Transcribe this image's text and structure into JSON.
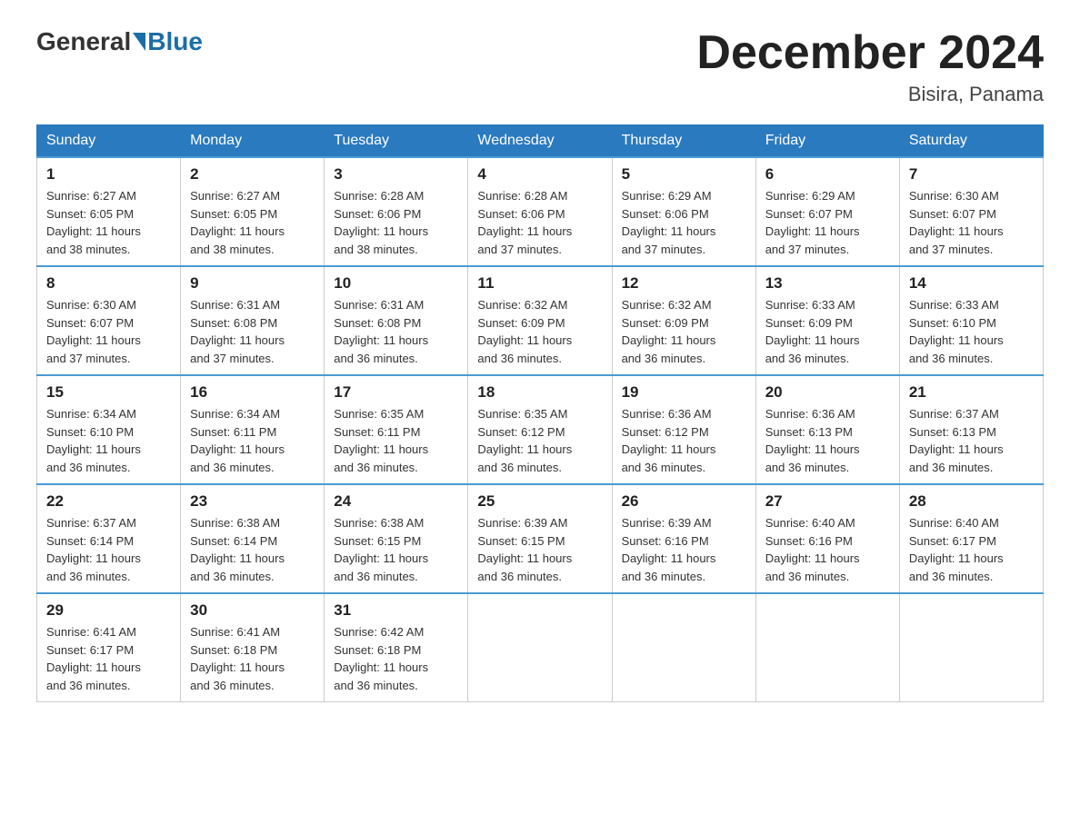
{
  "header": {
    "logo_general": "General",
    "logo_blue": "Blue",
    "title": "December 2024",
    "subtitle": "Bisira, Panama"
  },
  "days_of_week": [
    "Sunday",
    "Monday",
    "Tuesday",
    "Wednesday",
    "Thursday",
    "Friday",
    "Saturday"
  ],
  "weeks": [
    [
      {
        "date": "1",
        "sunrise": "6:27 AM",
        "sunset": "6:05 PM",
        "daylight": "11 hours and 38 minutes."
      },
      {
        "date": "2",
        "sunrise": "6:27 AM",
        "sunset": "6:05 PM",
        "daylight": "11 hours and 38 minutes."
      },
      {
        "date": "3",
        "sunrise": "6:28 AM",
        "sunset": "6:06 PM",
        "daylight": "11 hours and 38 minutes."
      },
      {
        "date": "4",
        "sunrise": "6:28 AM",
        "sunset": "6:06 PM",
        "daylight": "11 hours and 37 minutes."
      },
      {
        "date": "5",
        "sunrise": "6:29 AM",
        "sunset": "6:06 PM",
        "daylight": "11 hours and 37 minutes."
      },
      {
        "date": "6",
        "sunrise": "6:29 AM",
        "sunset": "6:07 PM",
        "daylight": "11 hours and 37 minutes."
      },
      {
        "date": "7",
        "sunrise": "6:30 AM",
        "sunset": "6:07 PM",
        "daylight": "11 hours and 37 minutes."
      }
    ],
    [
      {
        "date": "8",
        "sunrise": "6:30 AM",
        "sunset": "6:07 PM",
        "daylight": "11 hours and 37 minutes."
      },
      {
        "date": "9",
        "sunrise": "6:31 AM",
        "sunset": "6:08 PM",
        "daylight": "11 hours and 37 minutes."
      },
      {
        "date": "10",
        "sunrise": "6:31 AM",
        "sunset": "6:08 PM",
        "daylight": "11 hours and 36 minutes."
      },
      {
        "date": "11",
        "sunrise": "6:32 AM",
        "sunset": "6:09 PM",
        "daylight": "11 hours and 36 minutes."
      },
      {
        "date": "12",
        "sunrise": "6:32 AM",
        "sunset": "6:09 PM",
        "daylight": "11 hours and 36 minutes."
      },
      {
        "date": "13",
        "sunrise": "6:33 AM",
        "sunset": "6:09 PM",
        "daylight": "11 hours and 36 minutes."
      },
      {
        "date": "14",
        "sunrise": "6:33 AM",
        "sunset": "6:10 PM",
        "daylight": "11 hours and 36 minutes."
      }
    ],
    [
      {
        "date": "15",
        "sunrise": "6:34 AM",
        "sunset": "6:10 PM",
        "daylight": "11 hours and 36 minutes."
      },
      {
        "date": "16",
        "sunrise": "6:34 AM",
        "sunset": "6:11 PM",
        "daylight": "11 hours and 36 minutes."
      },
      {
        "date": "17",
        "sunrise": "6:35 AM",
        "sunset": "6:11 PM",
        "daylight": "11 hours and 36 minutes."
      },
      {
        "date": "18",
        "sunrise": "6:35 AM",
        "sunset": "6:12 PM",
        "daylight": "11 hours and 36 minutes."
      },
      {
        "date": "19",
        "sunrise": "6:36 AM",
        "sunset": "6:12 PM",
        "daylight": "11 hours and 36 minutes."
      },
      {
        "date": "20",
        "sunrise": "6:36 AM",
        "sunset": "6:13 PM",
        "daylight": "11 hours and 36 minutes."
      },
      {
        "date": "21",
        "sunrise": "6:37 AM",
        "sunset": "6:13 PM",
        "daylight": "11 hours and 36 minutes."
      }
    ],
    [
      {
        "date": "22",
        "sunrise": "6:37 AM",
        "sunset": "6:14 PM",
        "daylight": "11 hours and 36 minutes."
      },
      {
        "date": "23",
        "sunrise": "6:38 AM",
        "sunset": "6:14 PM",
        "daylight": "11 hours and 36 minutes."
      },
      {
        "date": "24",
        "sunrise": "6:38 AM",
        "sunset": "6:15 PM",
        "daylight": "11 hours and 36 minutes."
      },
      {
        "date": "25",
        "sunrise": "6:39 AM",
        "sunset": "6:15 PM",
        "daylight": "11 hours and 36 minutes."
      },
      {
        "date": "26",
        "sunrise": "6:39 AM",
        "sunset": "6:16 PM",
        "daylight": "11 hours and 36 minutes."
      },
      {
        "date": "27",
        "sunrise": "6:40 AM",
        "sunset": "6:16 PM",
        "daylight": "11 hours and 36 minutes."
      },
      {
        "date": "28",
        "sunrise": "6:40 AM",
        "sunset": "6:17 PM",
        "daylight": "11 hours and 36 minutes."
      }
    ],
    [
      {
        "date": "29",
        "sunrise": "6:41 AM",
        "sunset": "6:17 PM",
        "daylight": "11 hours and 36 minutes."
      },
      {
        "date": "30",
        "sunrise": "6:41 AM",
        "sunset": "6:18 PM",
        "daylight": "11 hours and 36 minutes."
      },
      {
        "date": "31",
        "sunrise": "6:42 AM",
        "sunset": "6:18 PM",
        "daylight": "11 hours and 36 minutes."
      },
      null,
      null,
      null,
      null
    ]
  ],
  "labels": {
    "sunrise": "Sunrise:",
    "sunset": "Sunset:",
    "daylight": "Daylight:"
  }
}
